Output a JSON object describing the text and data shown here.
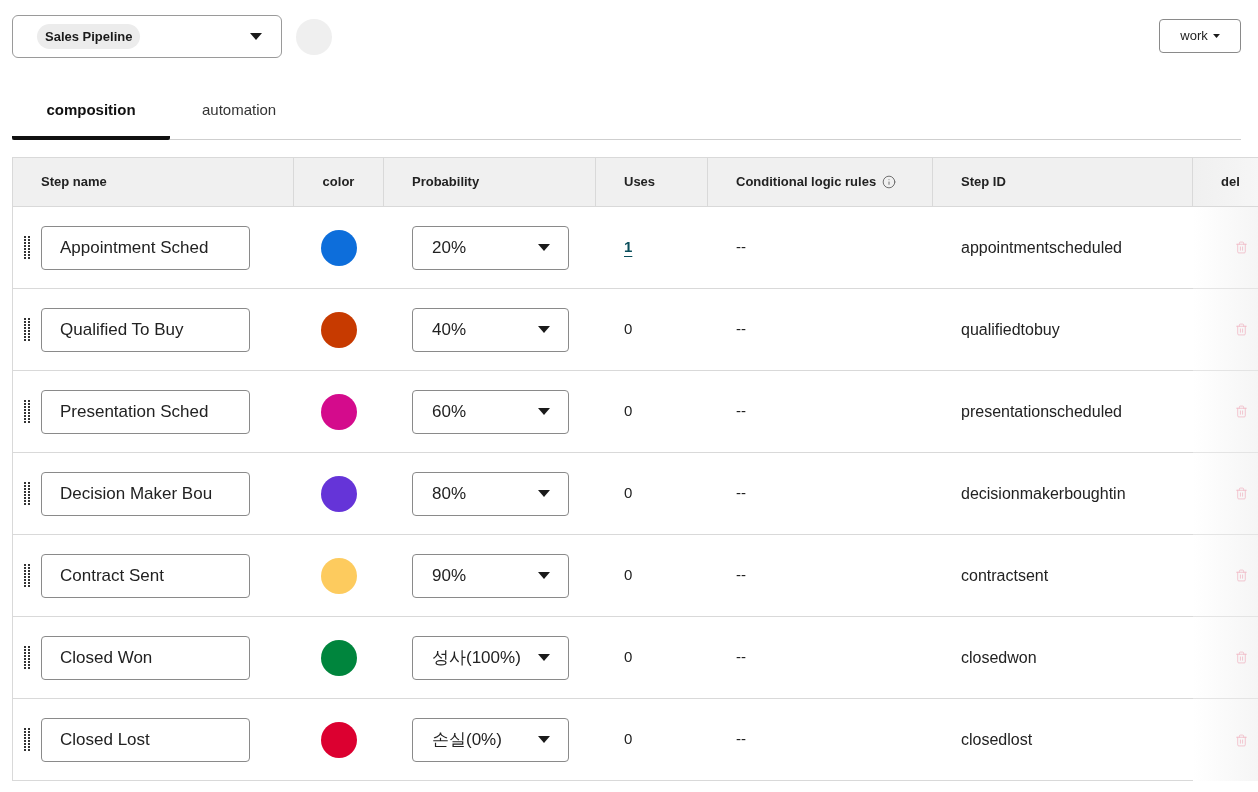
{
  "pipeline_select": {
    "value": "Sales Pipeline"
  },
  "workspace_button": {
    "label": "work"
  },
  "tabs": [
    {
      "label": "composition",
      "selected": true
    },
    {
      "label": "automation",
      "selected": false
    }
  ],
  "table": {
    "columns": [
      {
        "label": "Step name",
        "info": false
      },
      {
        "label": "color",
        "info": false
      },
      {
        "label": "Probability",
        "info": false
      },
      {
        "label": "Uses",
        "info": false
      },
      {
        "label": "Conditional logic rules",
        "info": true
      },
      {
        "label": "Step ID",
        "info": false
      },
      {
        "label": "del",
        "info": false
      }
    ],
    "rows": [
      {
        "step_name": "Appointment Sched",
        "color": "#0d6edb",
        "probability": "20%",
        "uses": "1",
        "uses_linked": true,
        "conditional_logic_rules": "--",
        "step_id": "appointmentscheduled"
      },
      {
        "step_name": "Qualified To Buy",
        "color": "#c73a00",
        "probability": "40%",
        "uses": "0",
        "uses_linked": false,
        "conditional_logic_rules": "--",
        "step_id": "qualifiedtobuy"
      },
      {
        "step_name": "Presentation Sched",
        "color": "#d40b8c",
        "probability": "60%",
        "uses": "0",
        "uses_linked": false,
        "conditional_logic_rules": "--",
        "step_id": "presentationscheduled"
      },
      {
        "step_name": "Decision Maker Bou",
        "color": "#6534d8",
        "probability": "80%",
        "uses": "0",
        "uses_linked": false,
        "conditional_logic_rules": "--",
        "step_id": "decisionmakerboughtin"
      },
      {
        "step_name": "Contract Sent",
        "color": "#fdcb5e",
        "probability": "90%",
        "uses": "0",
        "uses_linked": false,
        "conditional_logic_rules": "--",
        "step_id": "contractsent"
      },
      {
        "step_name": "Closed Won",
        "color": "#00853d",
        "probability": "성사(100%)",
        "uses": "0",
        "uses_linked": false,
        "conditional_logic_rules": "--",
        "step_id": "closedwon"
      },
      {
        "step_name": "Closed Lost",
        "color": "#dc0030",
        "probability": "손실(0%)",
        "uses": "0",
        "uses_linked": false,
        "conditional_logic_rules": "--",
        "step_id": "closedlost"
      }
    ]
  }
}
